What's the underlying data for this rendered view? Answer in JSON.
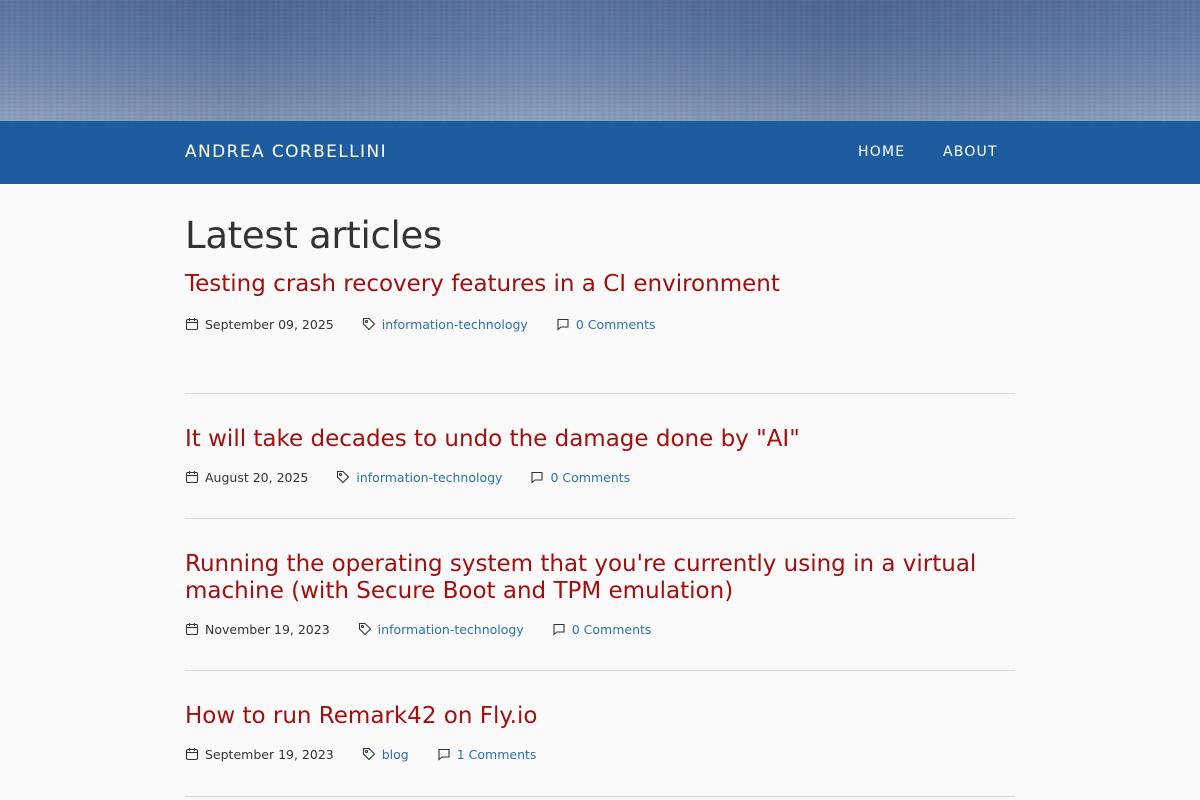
{
  "site": {
    "brand": "ANDREA CORBELLINI",
    "nav": [
      {
        "label": "HOME"
      },
      {
        "label": "ABOUT"
      }
    ]
  },
  "main": {
    "title": "Latest articles",
    "articles": [
      {
        "title": "Testing crash recovery features in a CI environment",
        "date": "September 09, 2025",
        "tag": "information-technology",
        "comments": "0 Comments"
      },
      {
        "title": "It will take decades to undo the damage done by \"AI\"",
        "date": "August 20, 2025",
        "tag": "information-technology",
        "comments": "0 Comments"
      },
      {
        "title": "Running the operating system that you're currently using in a virtual machine (with Secure Boot and TPM emulation)",
        "date": "November 19, 2023",
        "tag": "information-technology",
        "comments": "0 Comments"
      },
      {
        "title": "How to run Remark42 on Fly.io",
        "date": "September 19, 2023",
        "tag": "blog",
        "comments": "1 Comments"
      }
    ]
  },
  "icons": {
    "date": "calendar-icon",
    "tag": "tag-icon",
    "comments": "comment-icon"
  },
  "colors": {
    "navbar": "#1d5c9e",
    "article_title": "#a30e0e",
    "link": "#2f6fb0"
  }
}
